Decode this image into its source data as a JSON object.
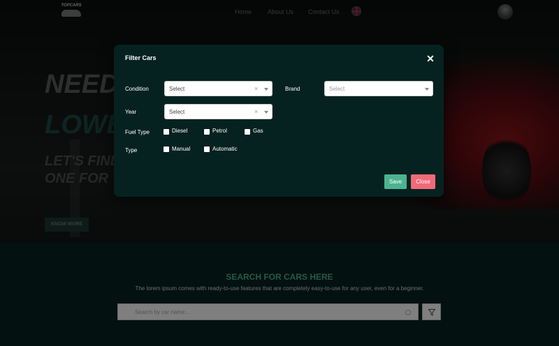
{
  "nav": {
    "logo_text": "TOPCARS",
    "links": [
      "Home",
      "About Us",
      "Contact Us"
    ]
  },
  "hero": {
    "line1": "NEED",
    "line2": "LOWE",
    "line3": "LET'S FIND",
    "line4": "ONE FOR Y",
    "button_label": "KNOW MORE"
  },
  "search": {
    "title": "SEARCH FOR CARS HERE",
    "subtitle": "The lorem ipsum comes with ready-to-use features that are completely easy-to-use for any user, even for a beginner.",
    "placeholder": "Search by car name...",
    "filter_icon": "filter-icon"
  },
  "modal": {
    "title": "Filter Cars",
    "close_icon": "close-icon",
    "condition": {
      "label": "Condition",
      "value": "Select"
    },
    "brand": {
      "label": "Brand",
      "value": "Select"
    },
    "year": {
      "label": "Year",
      "value": "Select"
    },
    "fuel": {
      "label": "Fuel Type",
      "options": [
        "Diesel",
        "Petrol",
        "Gas"
      ]
    },
    "type": {
      "label": "Type",
      "options": [
        "Manual",
        "Automatic"
      ]
    },
    "save_label": "Save",
    "close_label": "Close"
  },
  "colors": {
    "modal_bg": "#062220",
    "accent_green": "#4db28f",
    "close_red": "#f06a78",
    "heading_green": "#4fae8c"
  }
}
